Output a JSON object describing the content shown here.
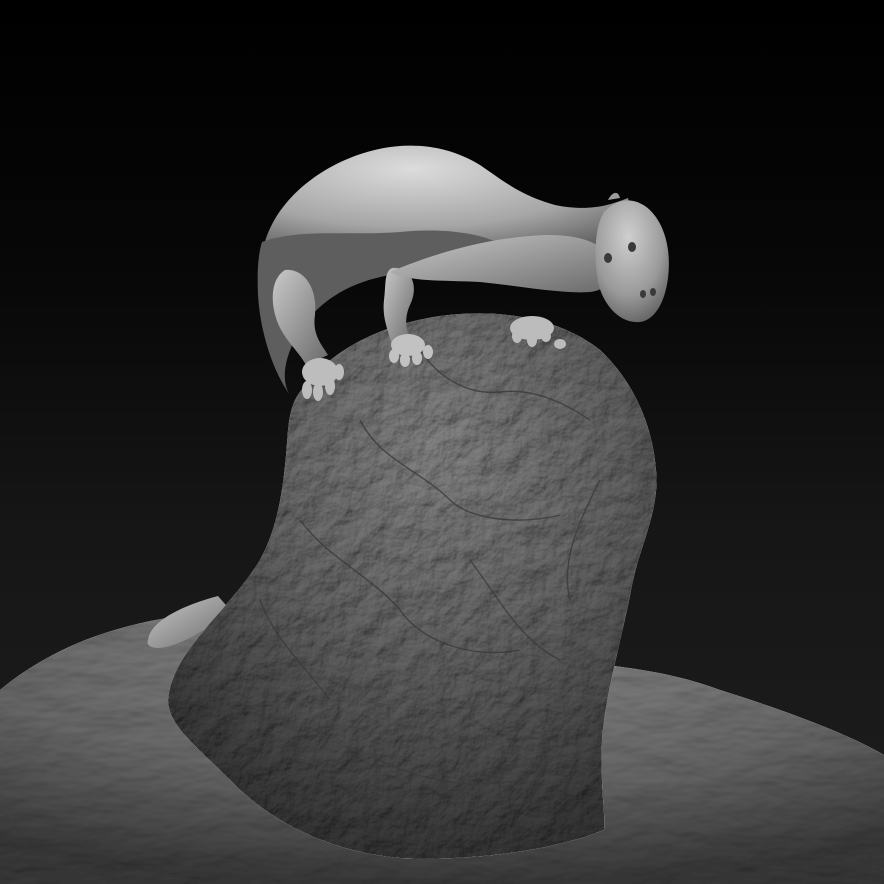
{
  "scene": {
    "subject": "sculpted-creature-on-rock",
    "render_style": "clay-matcap-grayscale",
    "colors": {
      "background_top": "#000000",
      "background_bottom": "#1e1e1e",
      "clay_highlight": "#d6d6d6",
      "clay_mid": "#8c8c8c",
      "clay_shadow": "#2e2e2e",
      "rock_mid": "#6f6f6f",
      "ground_mid": "#7a7a7a"
    }
  }
}
